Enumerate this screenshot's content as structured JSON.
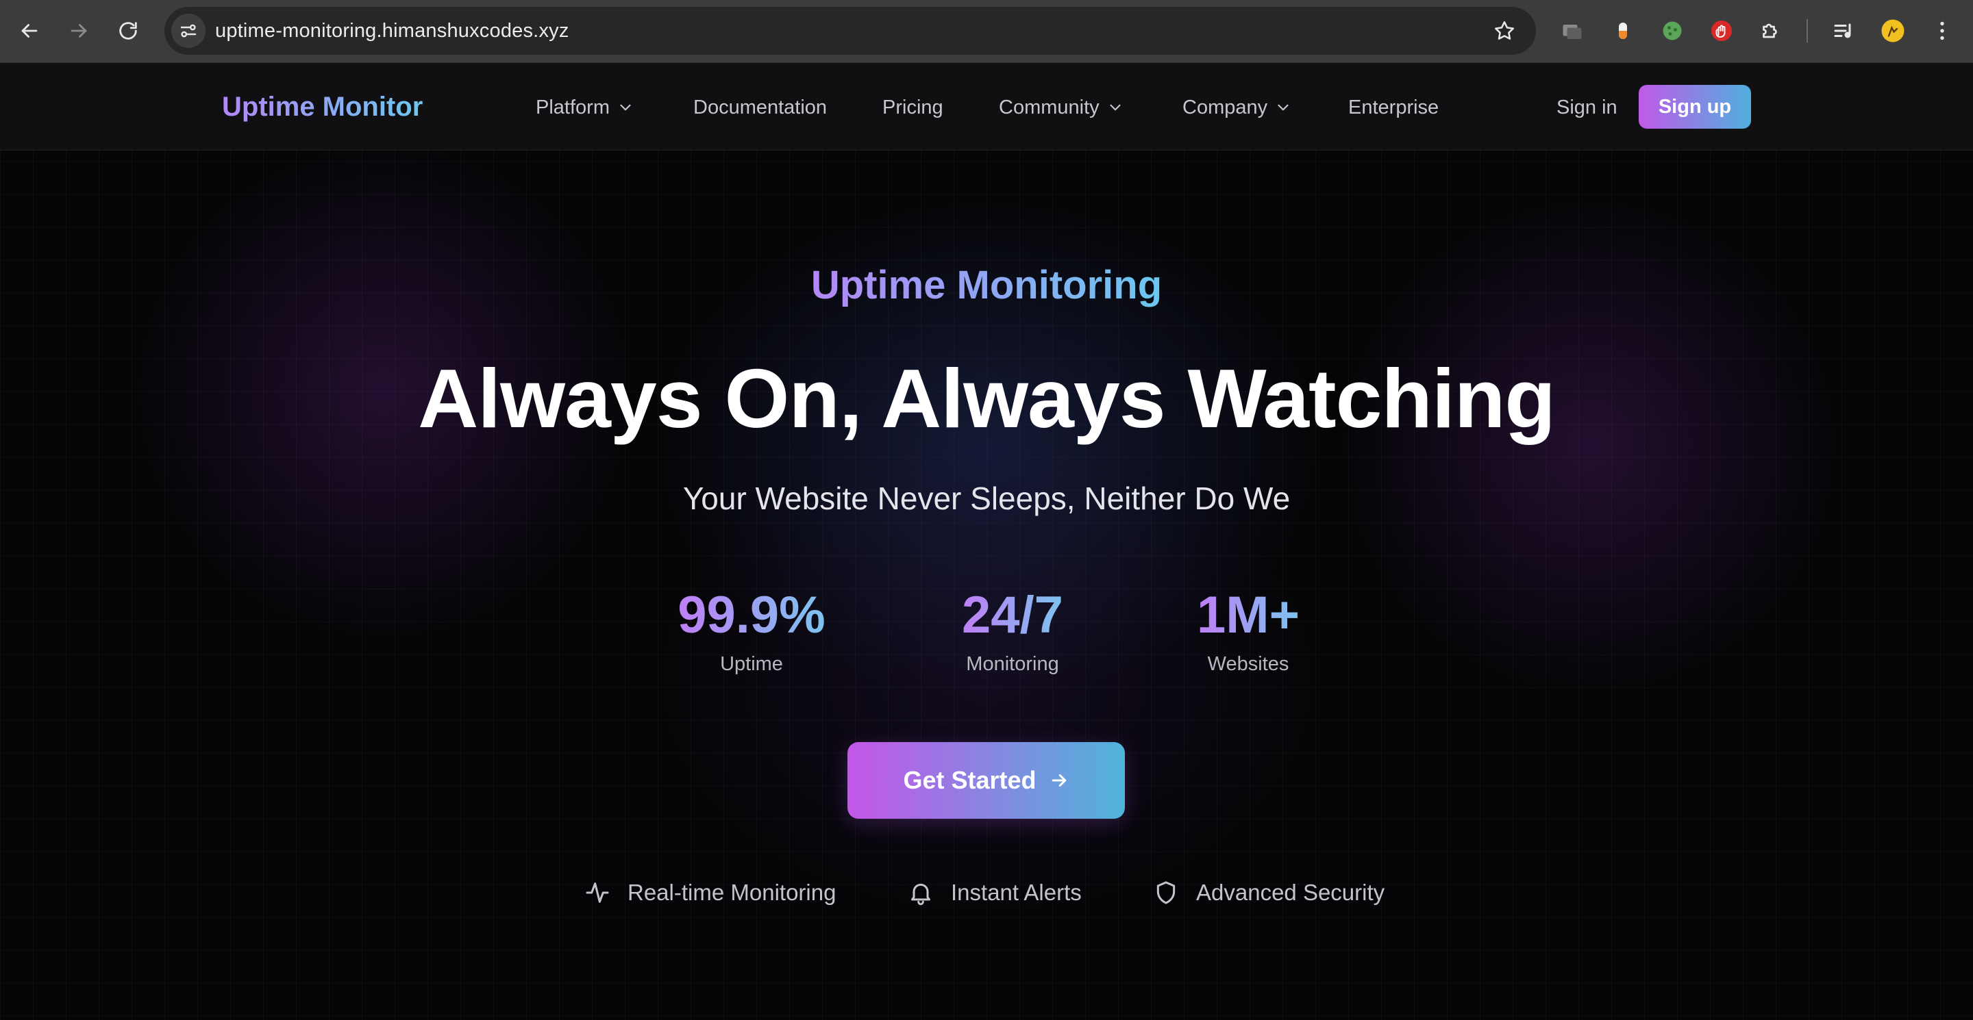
{
  "browser": {
    "url": "uptime-monitoring.himanshuxcodes.xyz"
  },
  "header": {
    "brand": "Uptime Monitor",
    "nav": {
      "platform": "Platform",
      "documentation": "Documentation",
      "pricing": "Pricing",
      "community": "Community",
      "company": "Company",
      "enterprise": "Enterprise"
    },
    "sign_in": "Sign in",
    "sign_up": "Sign up"
  },
  "hero": {
    "eyebrow": "Uptime Monitoring",
    "headline": "Always On, Always Watching",
    "subhead": "Your Website Never Sleeps, Neither Do We",
    "stats": [
      {
        "value": "99.9%",
        "label": "Uptime"
      },
      {
        "value": "24/7",
        "label": "Monitoring"
      },
      {
        "value": "1M+",
        "label": "Websites"
      }
    ],
    "cta": "Get Started",
    "features": [
      {
        "icon": "activity-icon",
        "label": "Real-time Monitoring"
      },
      {
        "icon": "bell-icon",
        "label": "Instant Alerts"
      },
      {
        "icon": "shield-icon",
        "label": "Advanced Security"
      }
    ]
  },
  "colors": {
    "brand_gradient_start": "#b487f8",
    "brand_gradient_end": "#6bc7f0",
    "cta_gradient_start": "#c456e8",
    "cta_gradient_end": "#4fb4da",
    "background": "#050507"
  }
}
